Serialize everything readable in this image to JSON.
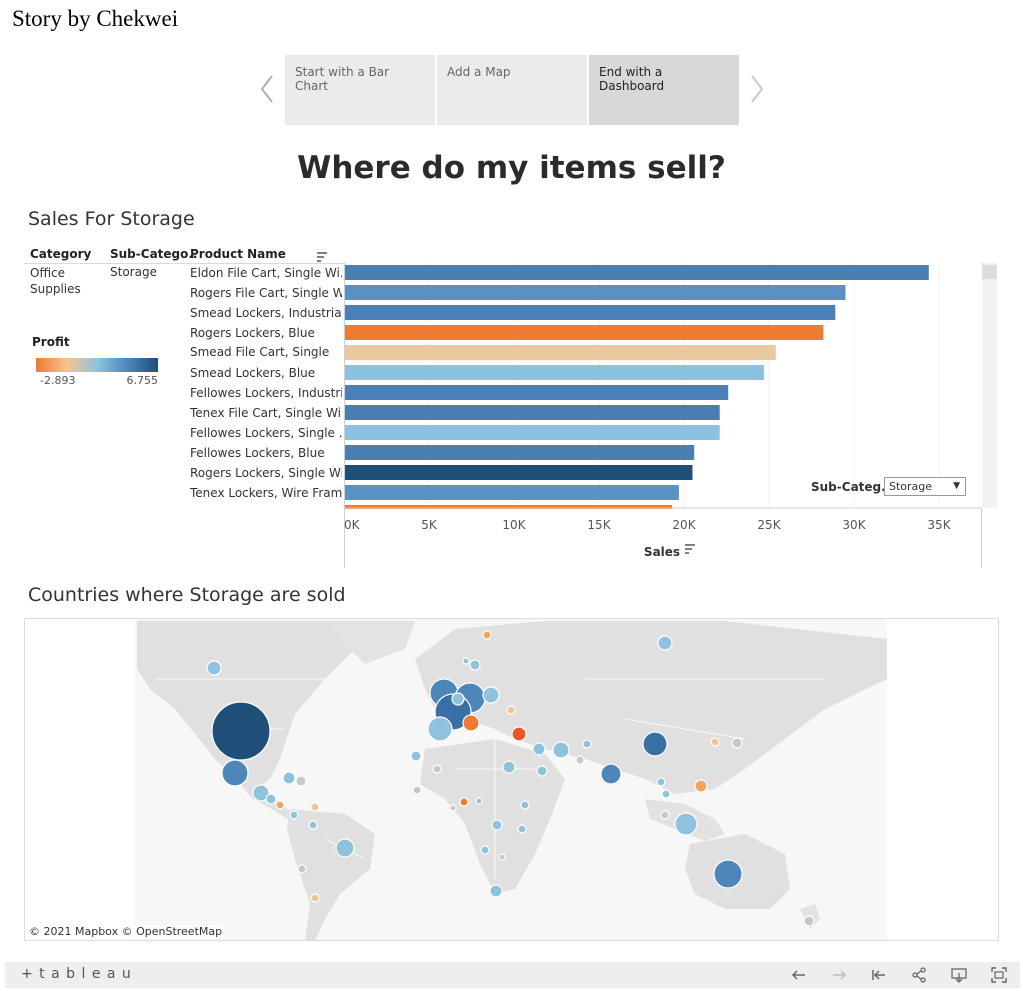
{
  "story": {
    "title": "Story by Chekwei",
    "prev_icon": "chevron-left-icon",
    "next_icon": "chevron-right-icon",
    "points": [
      {
        "label": "Start with a Bar Chart",
        "active": false
      },
      {
        "label": "Add a Map",
        "active": false
      },
      {
        "label": "End with a Dashboard",
        "active": true
      }
    ]
  },
  "dashboard": {
    "title": "Where do my items sell?"
  },
  "sales_sheet": {
    "title": "Sales For Storage",
    "headers": {
      "category": "Category",
      "subcategory": "Sub-Catego..",
      "product": "Product Name"
    },
    "category_value": "Office\nSupplies",
    "category_line1": "Office",
    "category_line2": "Supplies",
    "subcategory_value": "Storage",
    "sort_icon": "sort-descending-icon",
    "products": [
      "Eldon File Cart, Single Wi..",
      "Rogers File Cart, Single W..",
      "Smead Lockers, Industrial",
      "Rogers Lockers, Blue",
      "Smead File Cart, Single",
      "Smead Lockers, Blue",
      "Fellowes Lockers, Industri..",
      "Tenex File Cart, Single Wi..",
      "Fellowes Lockers, Single ..",
      "Fellowes Lockers, Blue",
      "Rogers Lockers, Single Wi..",
      "Tenex Lockers, Wire Frame"
    ],
    "legend": {
      "title": "Profit",
      "min_label": "-2,893",
      "max_label": "6,755",
      "colors": [
        "#f07a32",
        "#f5c48e",
        "#8fc3dd",
        "#4d86b8",
        "#1f4e79"
      ]
    },
    "filter": {
      "label": "Sub-Categ...",
      "value": "Storage",
      "dropdown_icon": "caret-down-icon"
    }
  },
  "chart_data": {
    "type": "bar",
    "orientation": "horizontal",
    "categories": [
      "Eldon File Cart, Single Wi..",
      "Rogers File Cart, Single W..",
      "Smead Lockers, Industrial",
      "Rogers Lockers, Blue",
      "Smead File Cart, Single",
      "Smead Lockers, Blue",
      "Fellowes Lockers, Industri..",
      "Tenex File Cart, Single Wi..",
      "Fellowes Lockers, Single ..",
      "Fellowes Lockers, Blue",
      "Rogers Lockers, Single Wi..",
      "Tenex Lockers, Wire Frame"
    ],
    "values": [
      34400,
      29500,
      28900,
      28200,
      25400,
      24700,
      22600,
      22100,
      22100,
      20600,
      20500,
      19700
    ],
    "partial_bar": {
      "value": 19300,
      "color": "#f07a32"
    },
    "bar_colors": [
      "#4a7fb0",
      "#5a90c2",
      "#4a80b5",
      "#f07a32",
      "#e9c9a0",
      "#8cc2e0",
      "#4a80b5",
      "#4a7db2",
      "#8cc2e0",
      "#4a7fb2",
      "#1f4e79",
      "#5a92c4"
    ],
    "xlabel": "Sales",
    "xlim": [
      0,
      36000
    ],
    "xticks": [
      {
        "value": 0,
        "label": "0K"
      },
      {
        "value": 5000,
        "label": "5K"
      },
      {
        "value": 10000,
        "label": "10K"
      },
      {
        "value": 15000,
        "label": "15K"
      },
      {
        "value": 20000,
        "label": "20K"
      },
      {
        "value": 25000,
        "label": "25K"
      },
      {
        "value": 30000,
        "label": "30K"
      },
      {
        "value": 35000,
        "label": "35K"
      }
    ],
    "grid": true
  },
  "map_sheet": {
    "title": "Countries where Storage are sold",
    "attribution": "© 2021 Mapbox  © OpenStreetMap"
  },
  "toolbar": {
    "logo": "+ t a b l e a u",
    "icons": [
      "undo-icon",
      "redo-icon",
      "revert-icon",
      "share-icon",
      "download-icon",
      "fullscreen-icon"
    ]
  }
}
